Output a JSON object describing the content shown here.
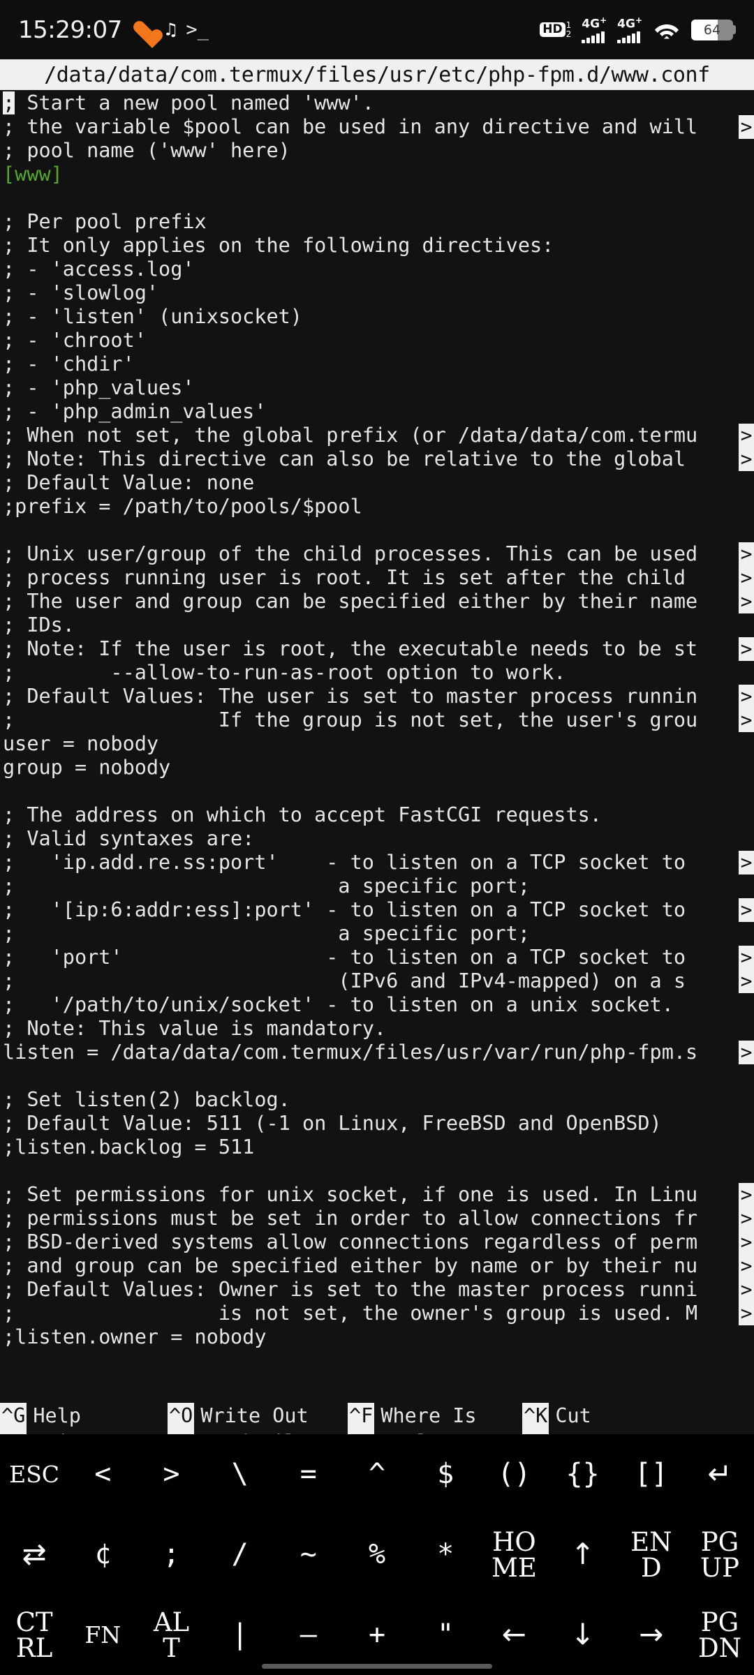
{
  "statusbar": {
    "clock": "15:29:07",
    "icons_left": [
      "heart-icon",
      "tiktok-icon",
      "terminal-prompt-icon"
    ],
    "hd": {
      "label": "HD",
      "sim1": "1",
      "sim2": "2"
    },
    "network": [
      {
        "label": "4G",
        "plus": "+",
        "bars": 5
      },
      {
        "label": "4G",
        "plus": "+",
        "bars": 5
      }
    ],
    "wifi": "wifi-icon",
    "battery": {
      "percent": "64",
      "level": 64
    }
  },
  "nano": {
    "title": "/data/data/com.termux/files/usr/etc/php-fpm.d/www.conf",
    "lines": [
      {
        "text": "; Start a new pool named 'www'.",
        "cursor": 0,
        "cont": false,
        "color": "white"
      },
      {
        "text": "; the variable $pool can be used in any directive and will",
        "cont": true,
        "color": "white"
      },
      {
        "text": "; pool name ('www' here)",
        "cont": false,
        "color": "white"
      },
      {
        "text": "[www]",
        "cont": false,
        "color": "green"
      },
      {
        "text": "",
        "cont": false,
        "color": "white"
      },
      {
        "text": "; Per pool prefix",
        "cont": false,
        "color": "white"
      },
      {
        "text": "; It only applies on the following directives:",
        "cont": false,
        "color": "white"
      },
      {
        "text": "; - 'access.log'",
        "cont": false,
        "color": "white"
      },
      {
        "text": "; - 'slowlog'",
        "cont": false,
        "color": "white"
      },
      {
        "text": "; - 'listen' (unixsocket)",
        "cont": false,
        "color": "white"
      },
      {
        "text": "; - 'chroot'",
        "cont": false,
        "color": "white"
      },
      {
        "text": "; - 'chdir'",
        "cont": false,
        "color": "white"
      },
      {
        "text": "; - 'php_values'",
        "cont": false,
        "color": "white"
      },
      {
        "text": "; - 'php_admin_values'",
        "cont": false,
        "color": "white"
      },
      {
        "text": "; When not set, the global prefix (or /data/data/com.termu",
        "cont": true,
        "color": "white"
      },
      {
        "text": "; Note: This directive can also be relative to the global ",
        "cont": true,
        "color": "white"
      },
      {
        "text": "; Default Value: none",
        "cont": false,
        "color": "white"
      },
      {
        "text": ";prefix = /path/to/pools/$pool",
        "cont": false,
        "color": "white"
      },
      {
        "text": "",
        "cont": false,
        "color": "white"
      },
      {
        "text": "; Unix user/group of the child processes. This can be used",
        "cont": true,
        "color": "white"
      },
      {
        "text": "; process running user is root. It is set after the child ",
        "cont": true,
        "color": "white"
      },
      {
        "text": "; The user and group can be specified either by their name",
        "cont": true,
        "color": "white"
      },
      {
        "text": "; IDs.",
        "cont": false,
        "color": "white"
      },
      {
        "text": "; Note: If the user is root, the executable needs to be st",
        "cont": true,
        "color": "white"
      },
      {
        "text": ";        --allow-to-run-as-root option to work.",
        "cont": false,
        "color": "white"
      },
      {
        "text": "; Default Values: The user is set to master process runnin",
        "cont": true,
        "color": "white"
      },
      {
        "text": ";                 If the group is not set, the user's grou",
        "cont": true,
        "color": "white"
      },
      {
        "text": "user = nobody",
        "cont": false,
        "color": "white"
      },
      {
        "text": "group = nobody",
        "cont": false,
        "color": "white"
      },
      {
        "text": "",
        "cont": false,
        "color": "white"
      },
      {
        "text": "; The address on which to accept FastCGI requests.",
        "cont": false,
        "color": "white"
      },
      {
        "text": "; Valid syntaxes are:",
        "cont": false,
        "color": "white"
      },
      {
        "text": ";   'ip.add.re.ss:port'    - to listen on a TCP socket to ",
        "cont": true,
        "color": "white"
      },
      {
        "text": ";                           a specific port;",
        "cont": false,
        "color": "white"
      },
      {
        "text": ";   '[ip:6:addr:ess]:port' - to listen on a TCP socket to ",
        "cont": true,
        "color": "white"
      },
      {
        "text": ";                           a specific port;",
        "cont": false,
        "color": "white"
      },
      {
        "text": ";   'port'                 - to listen on a TCP socket to ",
        "cont": true,
        "color": "white"
      },
      {
        "text": ";                           (IPv6 and IPv4-mapped) on a s",
        "cont": true,
        "color": "white"
      },
      {
        "text": ";   '/path/to/unix/socket' - to listen on a unix socket.",
        "cont": false,
        "color": "white"
      },
      {
        "text": "; Note: This value is mandatory.",
        "cont": false,
        "color": "white"
      },
      {
        "text": "listen = /data/data/com.termux/files/usr/var/run/php-fpm.s",
        "cont": true,
        "color": "white"
      },
      {
        "text": "",
        "cont": false,
        "color": "white"
      },
      {
        "text": "; Set listen(2) backlog.",
        "cont": false,
        "color": "white"
      },
      {
        "text": "; Default Value: 511 (-1 on Linux, FreeBSD and OpenBSD)",
        "cont": false,
        "color": "white"
      },
      {
        "text": ";listen.backlog = 511",
        "cont": false,
        "color": "white"
      },
      {
        "text": "",
        "cont": false,
        "color": "white"
      },
      {
        "text": "; Set permissions for unix socket, if one is used. In Linu",
        "cont": true,
        "color": "white"
      },
      {
        "text": "; permissions must be set in order to allow connections fr",
        "cont": true,
        "color": "white"
      },
      {
        "text": "; BSD-derived systems allow connections regardless of perm",
        "cont": true,
        "color": "white"
      },
      {
        "text": "; and group can be specified either by name or by their nu",
        "cont": true,
        "color": "white"
      },
      {
        "text": "; Default Values: Owner is set to the master process runni",
        "cont": true,
        "color": "white"
      },
      {
        "text": ";                 is not set, the owner's group is used. M",
        "cont": true,
        "color": "white"
      },
      {
        "text": ";listen.owner = nobody",
        "cont": false,
        "color": "white"
      }
    ],
    "continuation_marker": ">",
    "shortcuts": [
      [
        {
          "key": "^G",
          "label": "Help"
        },
        {
          "key": "^O",
          "label": "Write Out"
        },
        {
          "key": "^F",
          "label": "Where Is"
        },
        {
          "key": "^K",
          "label": "Cut"
        }
      ],
      [
        {
          "key": "^X",
          "label": "Exit"
        },
        {
          "key": "^R",
          "label": "Read File"
        },
        {
          "key": "^\\",
          "label": "Replace"
        },
        {
          "key": "^U",
          "label": "Paste"
        }
      ]
    ]
  },
  "extra_keys": {
    "rows": [
      [
        {
          "label": "ESC",
          "name": "esc-key",
          "style": "small"
        },
        {
          "label": "<",
          "name": "less-than-key",
          "style": "sym"
        },
        {
          "label": ">",
          "name": "greater-than-key",
          "style": "sym"
        },
        {
          "label": "\\",
          "name": "backslash-key",
          "style": "sym"
        },
        {
          "label": "=",
          "name": "equals-key",
          "style": "sym"
        },
        {
          "label": "^",
          "name": "caret-key",
          "style": "sym"
        },
        {
          "label": "$",
          "name": "dollar-key",
          "style": "sym"
        },
        {
          "label": "()",
          "name": "parentheses-key",
          "style": "sym"
        },
        {
          "label": "{}",
          "name": "braces-key",
          "style": "sym"
        },
        {
          "label": "[]",
          "name": "brackets-key",
          "style": "sym"
        },
        {
          "label": "↵",
          "name": "enter-key",
          "style": "arrow"
        }
      ],
      [
        {
          "label": "⇄",
          "name": "tab-key",
          "style": "arrow"
        },
        {
          "label": "¢",
          "name": "cent-key",
          "style": "sym"
        },
        {
          "label": ";",
          "name": "semicolon-key",
          "style": "sym"
        },
        {
          "label": "/",
          "name": "slash-key",
          "style": "sym"
        },
        {
          "label": "~",
          "name": "tilde-key",
          "style": "sym"
        },
        {
          "label": "%",
          "name": "percent-key",
          "style": "sym"
        },
        {
          "label": "*",
          "name": "asterisk-key",
          "style": "sym"
        },
        {
          "label": "HOME",
          "name": "home-key",
          "style": "two",
          "line1": "HO",
          "line2": "ME"
        },
        {
          "label": "↑",
          "name": "arrow-up-key",
          "style": "arrow"
        },
        {
          "label": "END",
          "name": "end-key",
          "style": "two",
          "line1": "EN",
          "line2": "D"
        },
        {
          "label": "PGUP",
          "name": "page-up-key",
          "style": "two",
          "line1": "PG",
          "line2": "UP"
        }
      ],
      [
        {
          "label": "CTRL",
          "name": "ctrl-key",
          "style": "two",
          "line1": "CT",
          "line2": "RL"
        },
        {
          "label": "FN",
          "name": "fn-key",
          "style": "small"
        },
        {
          "label": "ALT",
          "name": "alt-key",
          "style": "two",
          "line1": "AL",
          "line2": "T"
        },
        {
          "label": "|",
          "name": "pipe-key",
          "style": "sym"
        },
        {
          "label": "—",
          "name": "dash-key",
          "style": "sym"
        },
        {
          "label": "+",
          "name": "plus-key",
          "style": "sym"
        },
        {
          "label": "\"",
          "name": "quote-key",
          "style": "sym"
        },
        {
          "label": "←",
          "name": "arrow-left-key",
          "style": "arrow"
        },
        {
          "label": "↓",
          "name": "arrow-down-key",
          "style": "arrow"
        },
        {
          "label": "→",
          "name": "arrow-right-key",
          "style": "arrow"
        },
        {
          "label": "PGDN",
          "name": "page-down-key",
          "style": "two",
          "line1": "PG",
          "line2": "DN"
        }
      ]
    ]
  },
  "colors": {
    "terminal_bg": "#121212",
    "terminal_fg": "#e6e6e6",
    "inverse_bg": "#f0f0f0",
    "green": "#55a630",
    "keyboard_bg": "#000000",
    "status_bg": "#0e0e0e",
    "accent_orange": "#f4761b"
  }
}
